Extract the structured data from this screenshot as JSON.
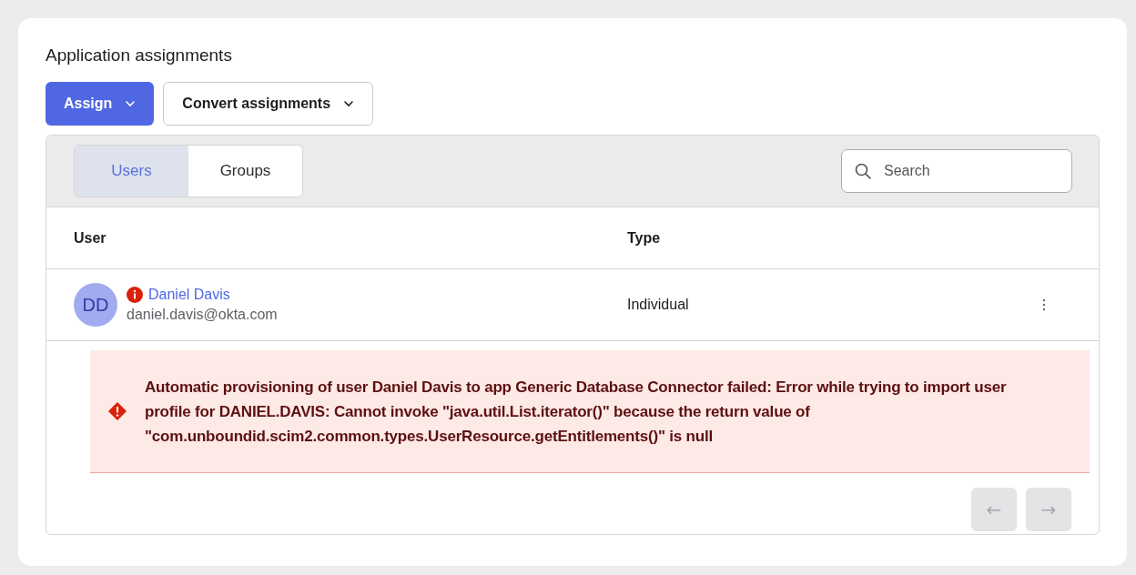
{
  "title": "Application assignments",
  "actions": [
    {
      "label": "Assign",
      "kind": "primary"
    },
    {
      "label": "Convert assignments",
      "kind": "secondary"
    }
  ],
  "tabs": [
    {
      "label": "Users",
      "selected": true
    },
    {
      "label": "Groups",
      "selected": false
    }
  ],
  "search": {
    "placeholder": "Search"
  },
  "table": {
    "columns": [
      "User",
      "Type"
    ],
    "rows": [
      {
        "initials": "DD",
        "name": "Daniel Davis",
        "email": "daniel.davis@okta.com",
        "error": true,
        "type": "Individual"
      }
    ]
  },
  "error_banner": {
    "message": "Automatic provisioning of user Daniel Davis to app Generic Database Connector failed: Error while trying to import user profile for DANIEL.DAVIS: Cannot invoke \"java.util.List.iterator()\" because the return value of \"com.unboundid.scim2.common.types.UserResource.getEntitlements()\" is null"
  },
  "pagination": [
    {
      "label": "←",
      "disabled": true
    },
    {
      "label": "→",
      "disabled": true
    }
  ]
}
